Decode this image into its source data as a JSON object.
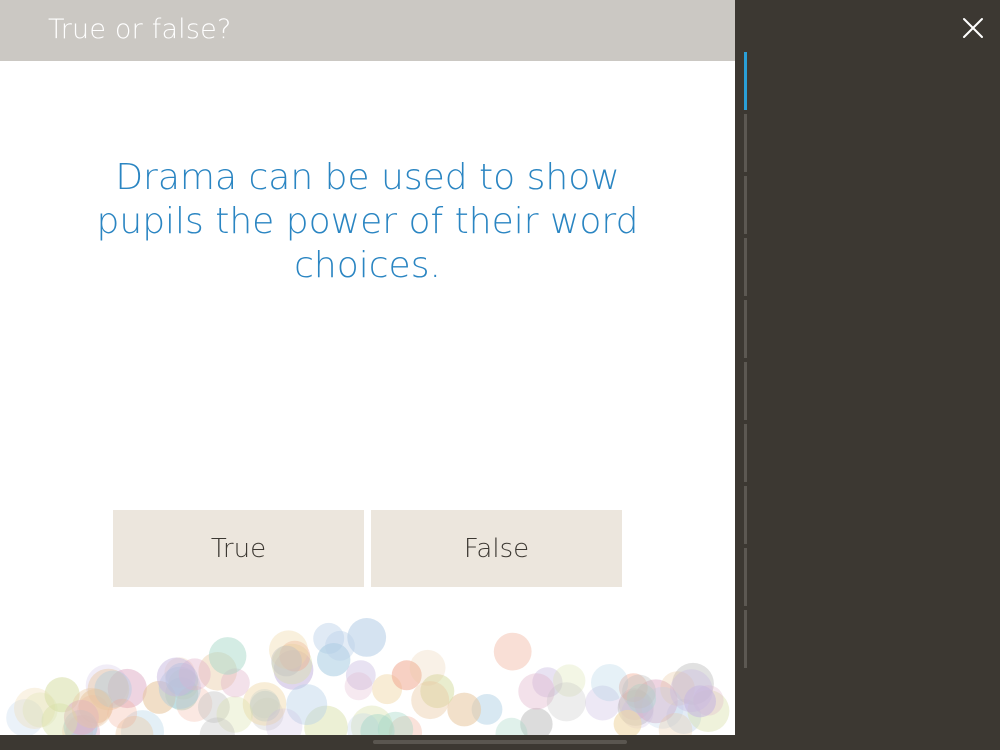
{
  "header": {
    "title": "True or false?"
  },
  "question": {
    "text": "Drama can be used to show pupils the power of their word choices."
  },
  "answers": [
    {
      "label": "True"
    },
    {
      "label": "False"
    }
  ],
  "progress": {
    "total_segments": 10,
    "current_segment": 1
  },
  "colors": {
    "background_dark": "#3c3832",
    "header_bar": "#cbc8c3",
    "question_text": "#2a85c2",
    "answer_button": "#ece6dd",
    "progress_active": "#2a9fd8"
  },
  "icons": {
    "close": "close-icon"
  }
}
